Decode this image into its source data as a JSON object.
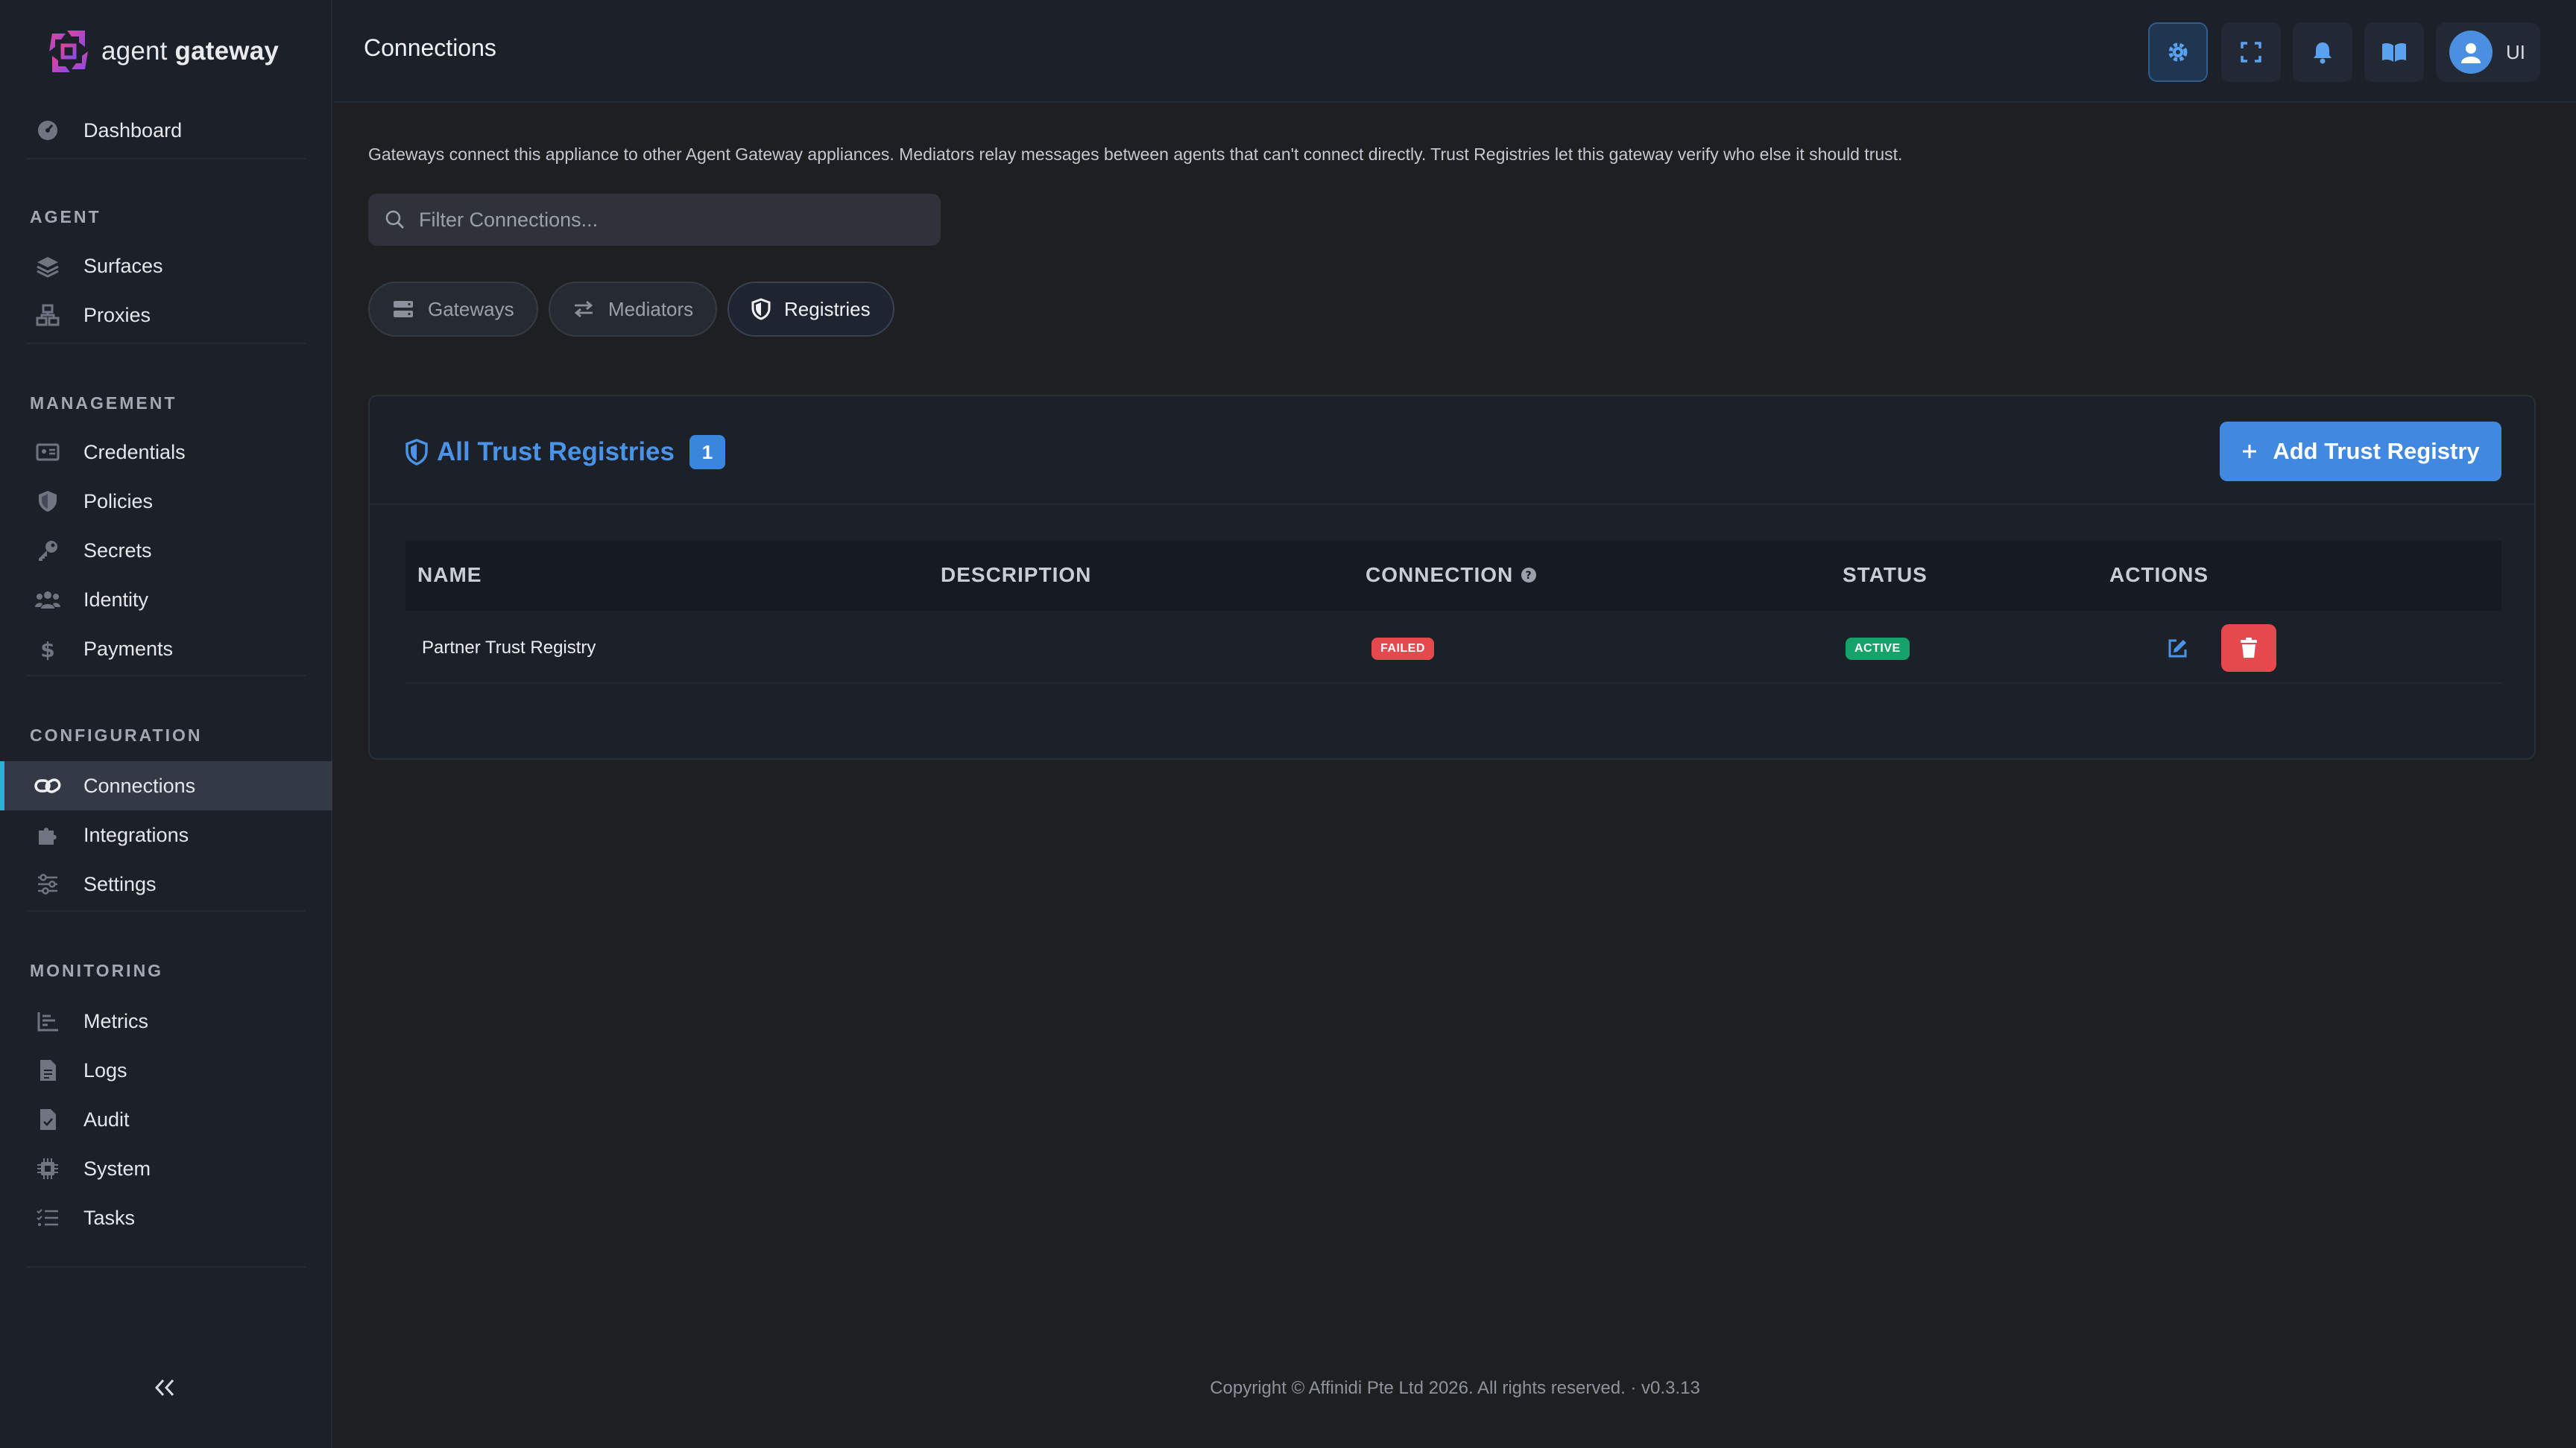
{
  "brand": {
    "name_light": "agent",
    "name_bold": "gateway"
  },
  "sidebar": {
    "dashboard": "Dashboard",
    "sections": {
      "agent": "AGENT",
      "management": "MANAGEMENT",
      "configuration": "CONFIGURATION",
      "monitoring": "MONITORING"
    },
    "agent_items": [
      "Surfaces",
      "Proxies"
    ],
    "management_items": [
      "Credentials",
      "Policies",
      "Secrets",
      "Identity",
      "Payments"
    ],
    "configuration_items": [
      "Connections",
      "Integrations",
      "Settings"
    ],
    "monitoring_items": [
      "Metrics",
      "Logs",
      "Audit",
      "System",
      "Tasks"
    ],
    "active_item": "Connections",
    "collapse_label": "<<"
  },
  "header": {
    "title": "Connections",
    "user_initials": "UI"
  },
  "main": {
    "intro": "Gateways connect this appliance to other Agent Gateway appliances. Mediators relay messages between agents that can't connect directly. Trust Registries let this gateway verify who else it should trust.",
    "filter_placeholder": "Filter Connections...",
    "tabs": [
      "Gateways",
      "Mediators",
      "Registries"
    ],
    "active_tab": "Registries"
  },
  "card": {
    "title": "All Trust Registries",
    "count": "1",
    "add_button": "Add Trust Registry",
    "columns": [
      "NAME",
      "DESCRIPTION",
      "CONNECTION",
      "STATUS",
      "ACTIONS"
    ],
    "rows": [
      {
        "name": "Partner Trust Registry",
        "description": "",
        "connection": "FAILED",
        "status": "ACTIVE"
      }
    ]
  },
  "colors": {
    "accent": "#4189e0",
    "active_indicator": "#25b3d6",
    "failed": "#e5484d",
    "active": "#16a36a"
  },
  "footer": "Copyright © Affinidi Pte Ltd 2026. All rights reserved. · v0.3.13"
}
